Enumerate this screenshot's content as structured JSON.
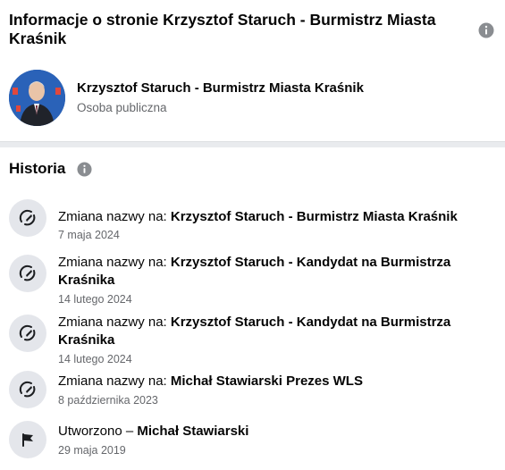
{
  "header": {
    "title": "Informacje o stronie Krzysztof Staruch - Burmistrz Miasta Kraśnik"
  },
  "page": {
    "name": "Krzysztof Staruch - Burmistrz Miasta Kraśnik",
    "category": "Osoba publiczna"
  },
  "history": {
    "heading": "Historia",
    "items": [
      {
        "prefix": "Zmiana nazwy na: ",
        "value": "Krzysztof Staruch - Burmistrz Miasta Kraśnik",
        "date": "7 maja 2024",
        "icon": "rename-icon"
      },
      {
        "prefix": "Zmiana nazwy na: ",
        "value": "Krzysztof Staruch - Kandydat na Burmistrza Kraśnika",
        "date": "14 lutego 2024",
        "icon": "rename-icon"
      },
      {
        "prefix": "Zmiana nazwy na: ",
        "value": "Krzysztof Staruch - Kandydat na Burmistrza Kraśnika",
        "date": "14 lutego 2024",
        "icon": "rename-icon"
      },
      {
        "prefix": "Zmiana nazwy na: ",
        "value": "Michał Stawiarski Prezes WLS",
        "date": "8 października 2023",
        "icon": "rename-icon"
      },
      {
        "prefix": "Utworzono – ",
        "value": "Michał Stawiarski",
        "date": "29 maja 2019",
        "icon": "flag-icon"
      }
    ]
  }
}
